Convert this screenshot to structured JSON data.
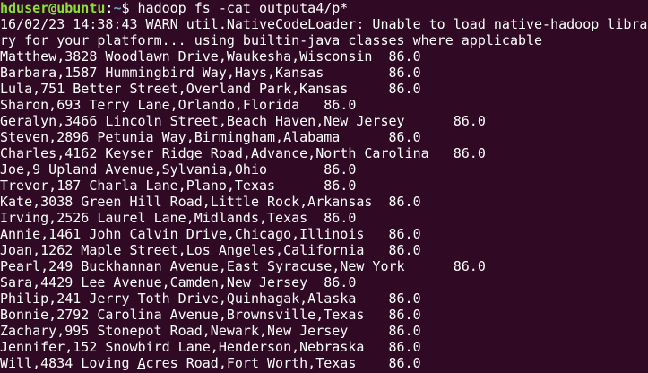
{
  "colors": {
    "background": "#300a24",
    "text": "#ffffff",
    "prompt_user": "#8ae234",
    "prompt_path": "#729fcf"
  },
  "prompt": {
    "user_host": "hduser@ubuntu",
    "separator": ":",
    "path": "~",
    "symbol": "$ ",
    "command": "hadoop fs -cat outputa4/p*"
  },
  "lines": [
    "16/02/23 14:38:43 WARN util.NativeCodeLoader: Unable to load native-hadoop libra",
    "ry for your platform... using builtin-java classes where applicable",
    "Matthew,3828 Woodlawn Drive,Waukesha,Wisconsin  86.0",
    "Barbara,1587 Hummingbird Way,Hays,Kansas        86.0",
    "Lula,751 Better Street,Overland Park,Kansas     86.0",
    "Sharon,693 Terry Lane,Orlando,Florida   86.0",
    "Geralyn,3466 Lincoln Street,Beach Haven,New Jersey      86.0",
    "Steven,2896 Petunia Way,Birmingham,Alabama      86.0",
    "Charles,4162 Keyser Ridge Road,Advance,North Carolina   86.0",
    "Joe,9 Upland Avenue,Sylvania,Ohio       86.0",
    "Trevor,187 Charla Lane,Plano,Texas      86.0",
    "Kate,3038 Green Hill Road,Little Rock,Arkansas  86.0",
    "Irving,2526 Laurel Lane,Midlands,Texas  86.0",
    "Annie,1461 John Calvin Drive,Chicago,Illinois   86.0",
    "Joan,1262 Maple Street,Los Angeles,California   86.0",
    "Pearl,249 Buckhannan Avenue,East Syracuse,New York      86.0",
    "Sara,4429 Lee Avenue,Camden,New Jersey  86.0",
    "Philip,241 Jerry Toth Drive,Quinhagak,Alaska    86.0",
    "Bonnie,2792 Carolina Avenue,Brownsville,Texas   86.0",
    "Zachary,995 Stonepot Road,Newark,New Jersey     86.0",
    "Jennifer,152 Snowbird Lane,Henderson,Nebraska   86.0",
    "Will,4834 Loving Acres Road,Fort Worth,Texas    86.0"
  ]
}
